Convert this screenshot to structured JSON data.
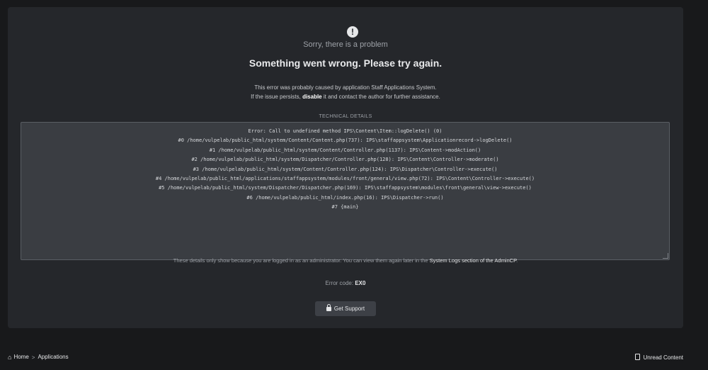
{
  "error": {
    "sorry": "Sorry, there is a problem",
    "headline": "Something went wrong. Please try again.",
    "cause_line1": "This error was probably caused by application Staff Applications System.",
    "cause_line2_prefix": "If the issue persists, ",
    "cause_disable": "disable",
    "cause_line2_suffix": " it and contact the author for further assistance.",
    "technical_heading": "TECHNICAL DETAILS",
    "trace": [
      "Error: Call to undefined method IPS\\Content\\Item::logDelete() (0)",
      "#0 /home/vulpelab/public_html/system/Content/Content.php(737): IPS\\staffappsystem\\Applicationrecord->logDelete()",
      "#1 /home/vulpelab/public_html/system/Content/Controller.php(1137): IPS\\Content->modAction()",
      "#2 /home/vulpelab/public_html/system/Dispatcher/Controller.php(128): IPS\\Content\\Controller->moderate()",
      "#3 /home/vulpelab/public_html/system/Content/Controller.php(124): IPS\\Dispatcher\\Controller->execute()",
      "#4 /home/vulpelab/public_html/applications/staffappsystem/modules/front/general/view.php(72): IPS\\Content\\Controller->execute()",
      "#5 /home/vulpelab/public_html/system/Dispatcher/Dispatcher.php(169): IPS\\staffappsystem\\modules\\front\\general\\view->execute()",
      "#6 /home/vulpelab/public_html/index.php(16): IPS\\Dispatcher->run()",
      "#7 {main}"
    ],
    "admin_note_prefix": "These details only show because you are logged in as an administrator. You can view them again later in the ",
    "admin_note_link": "System Logs section of the AdminCP",
    "admin_note_suffix": ".",
    "code_label": "Error code: ",
    "code_value": "EX0",
    "support_button": "Get Support"
  },
  "footer": {
    "home": "Home",
    "separator": ">",
    "applications": "Applications",
    "unread": "Unread Content"
  },
  "icons": {
    "alert": "alert-circle-icon",
    "lock": "lock-icon",
    "home": "home-icon",
    "unread": "document-icon"
  }
}
